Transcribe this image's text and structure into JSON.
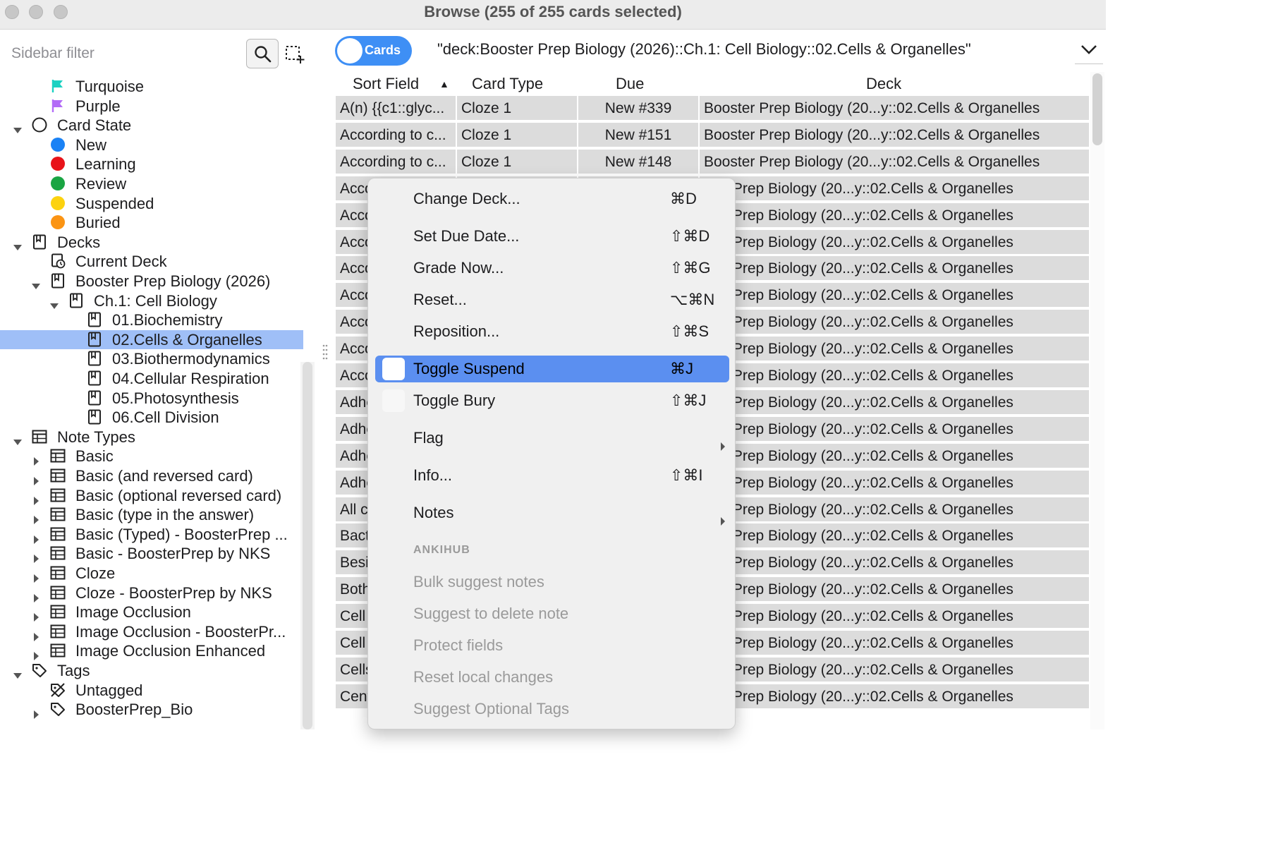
{
  "window": {
    "title": "Browse (255 of 255 cards selected)"
  },
  "sidebar": {
    "filter_placeholder": "Sidebar filter",
    "items": [
      {
        "label": "Turquoise",
        "icon": "flag-icon",
        "color": "#1bd1c2",
        "indent": 2,
        "arrow": ""
      },
      {
        "label": "Purple",
        "icon": "flag-icon",
        "color": "#b36cf7",
        "indent": 2,
        "arrow": ""
      },
      {
        "label": "Card State",
        "icon": "circle-outline-icon",
        "indent": 1,
        "arrow": "down"
      },
      {
        "label": "New",
        "icon": "dot-icon",
        "color": "#1a82f5",
        "indent": 2,
        "arrow": ""
      },
      {
        "label": "Learning",
        "icon": "dot-icon",
        "color": "#e8131a",
        "indent": 2,
        "arrow": ""
      },
      {
        "label": "Review",
        "icon": "dot-icon",
        "color": "#1aa543",
        "indent": 2,
        "arrow": ""
      },
      {
        "label": "Suspended",
        "icon": "dot-icon",
        "color": "#fcd20f",
        "indent": 2,
        "arrow": ""
      },
      {
        "label": "Buried",
        "icon": "dot-icon",
        "color": "#fb9413",
        "indent": 2,
        "arrow": ""
      },
      {
        "label": "Decks",
        "icon": "deck-icon",
        "indent": 1,
        "arrow": "down"
      },
      {
        "label": "Current Deck",
        "icon": "current-deck-icon",
        "indent": 2,
        "arrow": ""
      },
      {
        "label": "Booster Prep Biology (2026)",
        "icon": "deck-icon",
        "indent": 2,
        "arrow": "down"
      },
      {
        "label": "Ch.1: Cell Biology",
        "icon": "deck-icon",
        "indent": 3,
        "arrow": "down"
      },
      {
        "label": "01.Biochemistry",
        "icon": "deck-icon",
        "indent": 4,
        "arrow": ""
      },
      {
        "label": "02.Cells & Organelles",
        "icon": "deck-icon",
        "indent": 4,
        "arrow": "",
        "selected": true
      },
      {
        "label": "03.Biothermodynamics",
        "icon": "deck-icon",
        "indent": 4,
        "arrow": ""
      },
      {
        "label": "04.Cellular Respiration",
        "icon": "deck-icon",
        "indent": 4,
        "arrow": ""
      },
      {
        "label": "05.Photosynthesis",
        "icon": "deck-icon",
        "indent": 4,
        "arrow": ""
      },
      {
        "label": "06.Cell Division",
        "icon": "deck-icon",
        "indent": 4,
        "arrow": ""
      },
      {
        "label": "Note Types",
        "icon": "note-type-icon",
        "indent": 1,
        "arrow": "down"
      },
      {
        "label": "Basic",
        "icon": "note-type-icon",
        "indent": 2,
        "arrow": "right"
      },
      {
        "label": "Basic (and reversed card)",
        "icon": "note-type-icon",
        "indent": 2,
        "arrow": "right"
      },
      {
        "label": "Basic (optional reversed card)",
        "icon": "note-type-icon",
        "indent": 2,
        "arrow": "right"
      },
      {
        "label": "Basic (type in the answer)",
        "icon": "note-type-icon",
        "indent": 2,
        "arrow": "right"
      },
      {
        "label": "Basic (Typed) - BoosterPrep ...",
        "icon": "note-type-icon",
        "indent": 2,
        "arrow": "right"
      },
      {
        "label": "Basic - BoosterPrep by NKS",
        "icon": "note-type-icon",
        "indent": 2,
        "arrow": "right"
      },
      {
        "label": "Cloze",
        "icon": "note-type-icon",
        "indent": 2,
        "arrow": "right"
      },
      {
        "label": "Cloze - BoosterPrep by NKS",
        "icon": "note-type-icon",
        "indent": 2,
        "arrow": "right"
      },
      {
        "label": "Image Occlusion",
        "icon": "note-type-icon",
        "indent": 2,
        "arrow": "right"
      },
      {
        "label": "Image Occlusion - BoosterPr...",
        "icon": "note-type-icon",
        "indent": 2,
        "arrow": "right"
      },
      {
        "label": "Image Occlusion Enhanced",
        "icon": "note-type-icon",
        "indent": 2,
        "arrow": "right"
      },
      {
        "label": "Tags",
        "icon": "tag-icon",
        "indent": 1,
        "arrow": "down"
      },
      {
        "label": "Untagged",
        "icon": "untagged-icon",
        "indent": 2,
        "arrow": ""
      },
      {
        "label": "BoosterPrep_Bio",
        "icon": "tag-icon",
        "indent": 2,
        "arrow": "right"
      }
    ]
  },
  "toolbar": {
    "mode_toggle_label": "Cards",
    "search_query": "\"deck:Booster Prep Biology (2026)::Ch.1: Cell Biology::02.Cells & Organelles\""
  },
  "table": {
    "columns": [
      "Sort Field",
      "Card Type",
      "Due",
      "Deck"
    ],
    "sort_indicator": "▲",
    "rows": [
      [
        "A(n) {{c1::glyc...",
        "Cloze 1",
        "New #339",
        "Booster Prep Biology (20...y::02.Cells & Organelles"
      ],
      [
        "According to c...",
        "Cloze 1",
        "New #151",
        "Booster Prep Biology (20...y::02.Cells & Organelles"
      ],
      [
        "According to c...",
        "Cloze 1",
        "New #148",
        "Booster Prep Biology (20...y::02.Cells & Organelles"
      ],
      [
        "Acco",
        "",
        "",
        "ster Prep Biology (20...y::02.Cells & Organelles"
      ],
      [
        "Acco",
        "",
        "",
        "ster Prep Biology (20...y::02.Cells & Organelles"
      ],
      [
        "Acco",
        "",
        "",
        "ster Prep Biology (20...y::02.Cells & Organelles"
      ],
      [
        "Acco",
        "",
        "",
        "ster Prep Biology (20...y::02.Cells & Organelles"
      ],
      [
        "Acco",
        "",
        "",
        "ster Prep Biology (20...y::02.Cells & Organelles"
      ],
      [
        "Acco",
        "",
        "",
        "ster Prep Biology (20...y::02.Cells & Organelles"
      ],
      [
        "Acco",
        "",
        "",
        "ster Prep Biology (20...y::02.Cells & Organelles"
      ],
      [
        "Acco",
        "",
        "",
        "ster Prep Biology (20...y::02.Cells & Organelles"
      ],
      [
        "Adhe",
        "",
        "",
        "ster Prep Biology (20...y::02.Cells & Organelles"
      ],
      [
        "Adhe",
        "",
        "",
        "ster Prep Biology (20...y::02.Cells & Organelles"
      ],
      [
        "Adhe",
        "",
        "",
        "ster Prep Biology (20...y::02.Cells & Organelles"
      ],
      [
        "Adhe",
        "",
        "",
        "ster Prep Biology (20...y::02.Cells & Organelles"
      ],
      [
        "All c",
        "",
        "",
        "ster Prep Biology (20...y::02.Cells & Organelles"
      ],
      [
        "Bact",
        "",
        "",
        "ster Prep Biology (20...y::02.Cells & Organelles"
      ],
      [
        "Besi",
        "",
        "",
        "ster Prep Biology (20...y::02.Cells & Organelles"
      ],
      [
        "Both",
        "",
        "",
        "ster Prep Biology (20...y::02.Cells & Organelles"
      ],
      [
        "Cell",
        "",
        "",
        "ster Prep Biology (20...y::02.Cells & Organelles"
      ],
      [
        "Cell",
        "",
        "",
        "ster Prep Biology (20...y::02.Cells & Organelles"
      ],
      [
        "Cells",
        "",
        "",
        "ster Prep Biology (20...y::02.Cells & Organelles"
      ],
      [
        "Cent",
        "",
        "",
        "ster Prep Biology (20...y::02.Cells & Organelles"
      ]
    ]
  },
  "context_menu": {
    "items": [
      {
        "label": "Change Deck...",
        "shortcut": "⌘D"
      },
      {
        "label": "Set Due Date...",
        "shortcut": "⇧⌘D"
      },
      {
        "label": "Grade Now...",
        "shortcut": "⇧⌘G"
      },
      {
        "label": "Reset...",
        "shortcut": "⌥⌘N"
      },
      {
        "label": "Reposition...",
        "shortcut": "⇧⌘S"
      },
      {
        "label": "Toggle Suspend",
        "shortcut": "⌘J",
        "highlighted": true
      },
      {
        "label": "Toggle Bury",
        "shortcut": "⇧⌘J"
      },
      {
        "label": "Flag",
        "shortcut": "",
        "submenu": true
      },
      {
        "label": "Info...",
        "shortcut": "⇧⌘I"
      },
      {
        "label": "Notes",
        "shortcut": "",
        "submenu": true
      }
    ],
    "section_header": "ANKIHUB",
    "section_items": [
      "Bulk suggest notes",
      "Suggest to delete note",
      "Protect fields",
      "Reset local changes",
      "Suggest Optional Tags"
    ]
  }
}
